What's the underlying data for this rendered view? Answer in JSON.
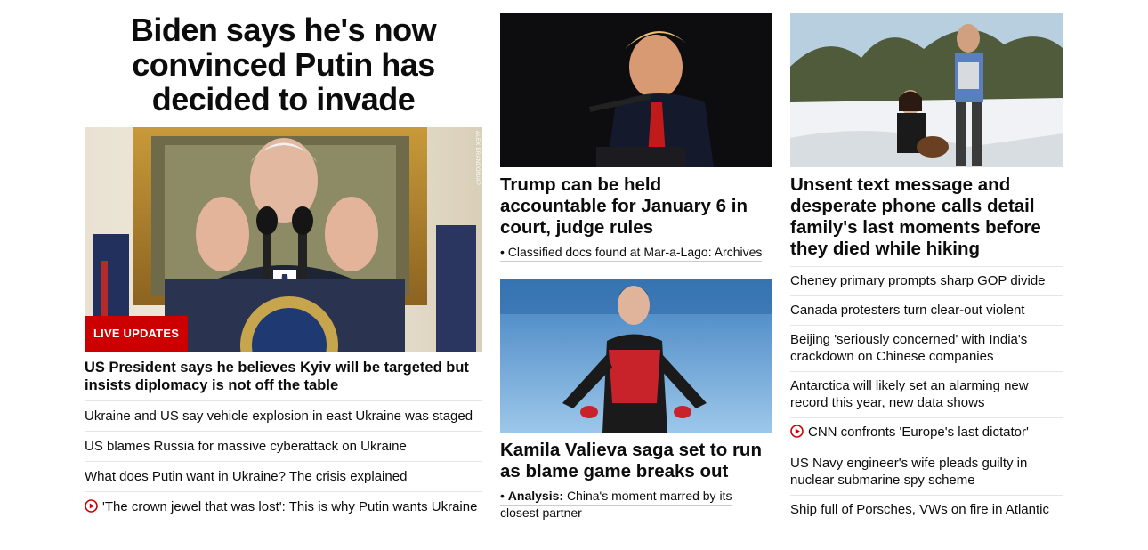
{
  "column1": {
    "big_headline": "Biden says he's now convinced Putin has decided to invade",
    "hero_image_alt": "Biden at podium",
    "photo_credit": "ALEX BRANDON/AP",
    "badge": "LIVE UPDATES",
    "lead_headline": "US President says he believes Kyiv will be targeted but insists diplomacy is not off the table",
    "items": [
      {
        "label": "Ukraine and US say vehicle explosion in east Ukraine was staged",
        "video": false
      },
      {
        "label": "US blames Russia for massive cyberattack on Ukraine",
        "video": false
      },
      {
        "label": "What does Putin want in Ukraine? The crisis explained",
        "video": false
      },
      {
        "label": "'The crown jewel that was lost': This is why Putin wants Ukraine",
        "video": true
      }
    ]
  },
  "column2": {
    "card1": {
      "headline": "Trump can be held accountable for January 6 in court, judge rules",
      "sub": "Classified docs found at Mar-a-Lago: Archives"
    },
    "card2": {
      "headline": "Kamila Valieva saga set to run as blame game breaks out",
      "sub_prefix": "Analysis:",
      "sub": "China's moment marred by its closest partner"
    }
  },
  "column3": {
    "headline": "Unsent text message and desperate phone calls detail family's last moments before they died while hiking",
    "items": [
      {
        "label": "Cheney primary prompts sharp GOP divide",
        "video": false
      },
      {
        "label": "Canada protesters turn clear-out violent",
        "video": false
      },
      {
        "label": "Beijing 'seriously concerned' with India's crackdown on Chinese companies",
        "video": false
      },
      {
        "label": "Antarctica will likely set an alarming new record this year, new data shows",
        "video": false
      },
      {
        "label": "CNN confronts 'Europe's last dictator'",
        "video": true
      },
      {
        "label": "US Navy engineer's wife pleads guilty in nuclear submarine spy scheme",
        "video": false
      },
      {
        "label": "Ship full of Porsches, VWs on fire in Atlantic",
        "video": false
      }
    ]
  },
  "colors": {
    "accent_red": "#cc0000",
    "text": "#0c0c0c",
    "divider": "#e6e6e6"
  },
  "icons": {
    "video": "play-circle-icon"
  }
}
